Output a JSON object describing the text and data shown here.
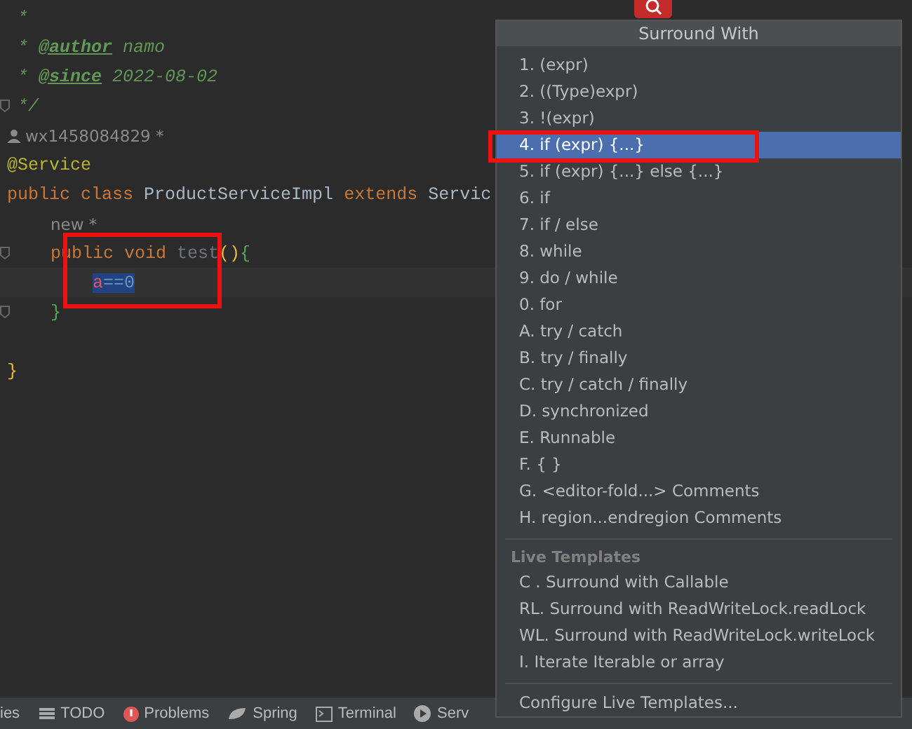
{
  "editor": {
    "lines": [
      {
        "kind": "code",
        "fold": false,
        "current": false,
        "tokens": [
          {
            "text": " *",
            "kind": "comment"
          }
        ]
      },
      {
        "kind": "code",
        "fold": false,
        "current": false,
        "tokens": [
          {
            "text": " * ",
            "kind": "comment"
          },
          {
            "text": "@author",
            "kind": "doctag"
          },
          {
            "text": " namo",
            "kind": "comment"
          }
        ]
      },
      {
        "kind": "code",
        "fold": false,
        "current": false,
        "tokens": [
          {
            "text": " * ",
            "kind": "comment"
          },
          {
            "text": "@since",
            "kind": "doctag"
          },
          {
            "text": " 2022-08-02",
            "kind": "comment"
          }
        ]
      },
      {
        "kind": "code",
        "fold": true,
        "current": false,
        "tokens": [
          {
            "text": " */",
            "kind": "comment"
          }
        ]
      },
      {
        "kind": "author",
        "fold": false,
        "current": false,
        "tokens": [
          {
            "text": "wx1458084829 *",
            "kind": "hint"
          }
        ]
      },
      {
        "kind": "code",
        "fold": false,
        "current": false,
        "tokens": [
          {
            "text": "@Service",
            "kind": "annotation"
          }
        ]
      },
      {
        "kind": "code",
        "fold": false,
        "current": false,
        "tokens": [
          {
            "text": "public class ",
            "kind": "keyword"
          },
          {
            "text": "ProductServiceImpl ",
            "kind": "plain"
          },
          {
            "text": "extends ",
            "kind": "keyword"
          },
          {
            "text": "Servic",
            "kind": "plain"
          }
        ]
      },
      {
        "kind": "member",
        "fold": false,
        "current": false,
        "tokens": [
          {
            "text": "new *",
            "kind": "hint"
          }
        ]
      },
      {
        "kind": "member",
        "fold": true,
        "current": false,
        "tokens": [
          {
            "text": "public void ",
            "kind": "keyword"
          },
          {
            "text": "test",
            "kind": "unused"
          },
          {
            "text": "()",
            "kind": "paren"
          },
          {
            "text": "{",
            "kind": "brace"
          }
        ]
      },
      {
        "kind": "body",
        "fold": false,
        "current": true,
        "tokens": [
          {
            "text": "a",
            "kind": "selvar"
          },
          {
            "text": "==0",
            "kind": "selected"
          }
        ]
      },
      {
        "kind": "member",
        "fold": true,
        "current": false,
        "tokens": [
          {
            "text": "}",
            "kind": "brace"
          }
        ]
      },
      {
        "kind": "blank"
      },
      {
        "kind": "code",
        "fold": false,
        "current": false,
        "tokens": [
          {
            "text": "}",
            "kind": "brace2"
          }
        ]
      }
    ]
  },
  "status_bar": [
    {
      "label": "ies"
    },
    {
      "label": "TODO"
    },
    {
      "label": "Problems"
    },
    {
      "label": "Spring"
    },
    {
      "label": "Terminal"
    },
    {
      "label": "Serv"
    }
  ],
  "popup": {
    "title": "Surround With",
    "items": [
      {
        "label": "1. (expr)",
        "selected": false
      },
      {
        "label": "2. ((Type)expr)",
        "selected": false
      },
      {
        "label": "3. !(expr)",
        "selected": false
      },
      {
        "label": "4. if (expr) {...}",
        "selected": true
      },
      {
        "label": "5. if (expr) {...} else {...}",
        "selected": false
      },
      {
        "label": "6. if",
        "selected": false
      },
      {
        "label": "7. if / else",
        "selected": false
      },
      {
        "label": "8. while",
        "selected": false
      },
      {
        "label": "9. do / while",
        "selected": false
      },
      {
        "label": "0. for",
        "selected": false
      },
      {
        "label": "A. try / catch",
        "selected": false
      },
      {
        "label": "B. try / finally",
        "selected": false
      },
      {
        "label": "C. try / catch / finally",
        "selected": false
      },
      {
        "label": "D. synchronized",
        "selected": false
      },
      {
        "label": "E. Runnable",
        "selected": false
      },
      {
        "label": "F. { }",
        "selected": false
      },
      {
        "label": "G. <editor-fold...> Comments",
        "selected": false
      },
      {
        "label": "H. region...endregion Comments",
        "selected": false
      }
    ],
    "live_templates": {
      "header": "Live Templates",
      "items": [
        {
          "label": "C . Surround with Callable",
          "selected": false
        },
        {
          "label": "RL. Surround with ReadWriteLock.readLock",
          "selected": false
        },
        {
          "label": "WL. Surround with ReadWriteLock.writeLock",
          "selected": false
        },
        {
          "label": "I. Iterate Iterable or array",
          "selected": false
        }
      ]
    },
    "footer_action": "Configure Live Templates..."
  }
}
